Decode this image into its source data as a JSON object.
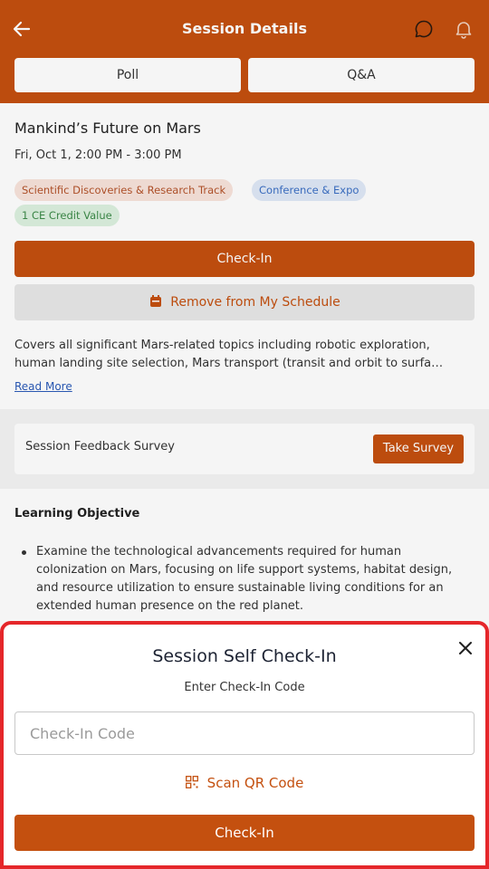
{
  "header": {
    "title": "Session Details",
    "tabs": [
      {
        "label": "Poll"
      },
      {
        "label": "Q&A"
      }
    ],
    "icons": [
      "arrow-left-icon",
      "chat-bubble-icon",
      "bell-icon"
    ],
    "bg_color": "#c4500f"
  },
  "session": {
    "title": "Mankind’s Future on Mars",
    "datetime": "Fri, Oct 1, 2:00 PM - 3:00 PM",
    "tags": [
      {
        "label": "Scientific Discoveries & Research Track"
      },
      {
        "label": "Conference & Expo"
      },
      {
        "label": "1 CE Credit Value"
      }
    ],
    "checkin_label": "Check-In",
    "remove_label": "Remove from My Schedule",
    "description": "Covers all significant Mars-related topics including robotic exploration, human landing site selection, Mars transport (transit and orbit to surfa…",
    "read_more": "Read More"
  },
  "survey": {
    "label": "Session Feedback Survey",
    "button": "Take Survey"
  },
  "learning": {
    "heading": "Learning Objective",
    "items": [
      "Examine the technological advancements required for human colonization on Mars, focusing on life support systems, habitat design, and resource utilization to ensure sustainable living conditions for an extended human presence on the red planet."
    ]
  },
  "checkin_sheet": {
    "title": "Session Self Check-In",
    "subtitle": "Enter Check-In Code",
    "placeholder": "Check-In Code",
    "scan_label": "Scan QR Code",
    "button": "Check-In",
    "accent_color": "#c4500f",
    "highlight_color": "#e5262a"
  }
}
